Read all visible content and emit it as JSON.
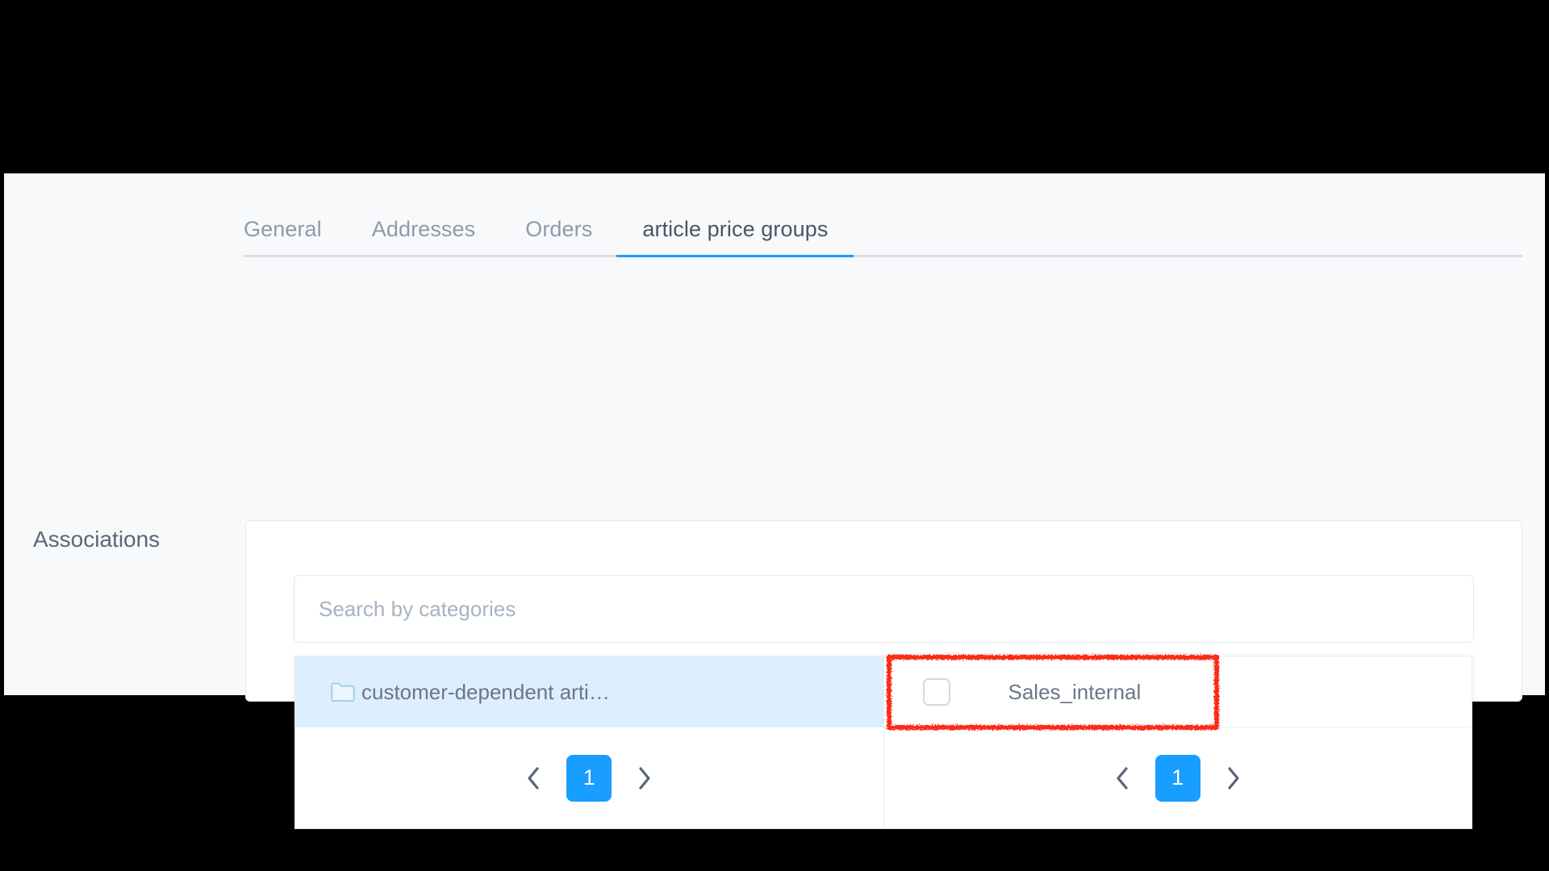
{
  "app": {
    "background_color": "#f7f9fb",
    "accent_color": "#189eff",
    "annotation_color": "#fb2b12"
  },
  "tabs": [
    {
      "label": "General",
      "active": false
    },
    {
      "label": "Addresses",
      "active": false
    },
    {
      "label": "Orders",
      "active": false
    },
    {
      "label": "article price groups",
      "active": true
    }
  ],
  "associations": {
    "section_label": "Associations",
    "search": {
      "placeholder": "Search by categories",
      "value": ""
    },
    "left_panel": {
      "items": [
        {
          "icon": "folder-icon",
          "label": "customer-dependent arti…",
          "highlighted": true
        }
      ],
      "pagination": {
        "prev_label": "‹",
        "next_label": "›",
        "current_page": "1"
      }
    },
    "right_panel": {
      "items": [
        {
          "icon": "checkbox",
          "label": "Sales_internal",
          "checked": false,
          "annotated": true
        }
      ],
      "pagination": {
        "prev_label": "‹",
        "next_label": "›",
        "current_page": "1"
      }
    }
  }
}
